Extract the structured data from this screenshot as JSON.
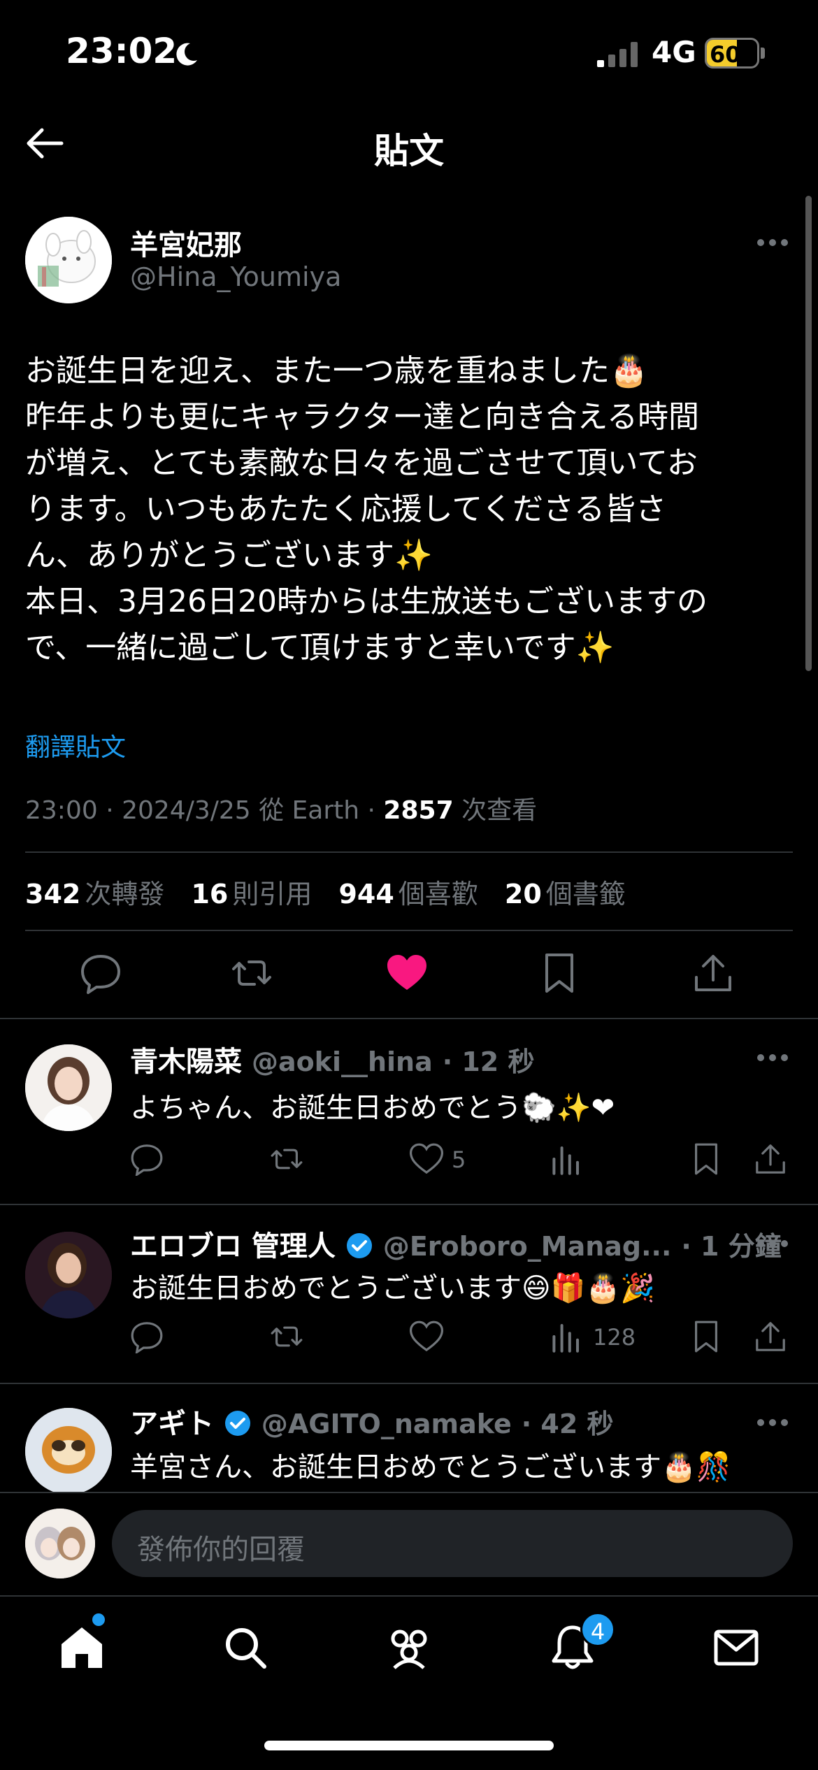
{
  "status_bar": {
    "time": "23:02",
    "network": "4G",
    "battery": "60"
  },
  "header": {
    "title": "貼文"
  },
  "tweet": {
    "author_name": "羊宮妃那",
    "author_handle": "@Hina_Youmiya",
    "text_lines": [
      "お誕生日を迎え、また一つ歳を重ねました🎂",
      "昨年よりも更にキャラクター達と向き合える時間",
      "が増え、とても素敵な日々を過ごさせて頂いてお",
      "ります。いつもあたたく応援してくださる皆さ",
      "ん、ありがとうございます✨",
      "本日、3月26日20時からは生放送もございますの",
      "で、一緒に過ごして頂けますと幸いです✨"
    ],
    "translate_label": "翻譯貼文",
    "meta_prefix": "23:00 · 2024/3/25 從 Earth · ",
    "views": "2857",
    "views_label": "次查看",
    "stats": {
      "retweets": "342",
      "retweets_label": "次轉發",
      "quotes": "16",
      "quotes_label": "則引用",
      "likes": "944",
      "likes_label": "個喜歡",
      "bookmarks": "20",
      "bookmarks_label": "個書籤"
    }
  },
  "replies": [
    {
      "name": "青木陽菜",
      "handle": "@aoki__hina",
      "time": "· 12 秒",
      "text": "よちゃん、お誕生日おめでとう🐑✨❤",
      "likes": "5",
      "views": ""
    },
    {
      "name": "エロブロ 管理人",
      "handle": "@Eroboro_Manag...",
      "time": "· 1 分鐘",
      "text": "お誕生日おめでとうございます😄🎁🎂🎉",
      "likes": "",
      "views": "128"
    },
    {
      "name": "アギト",
      "handle": "@AGITO_namake",
      "time": "· 42 秒",
      "text": "羊宮さん、お誕生日おめでとうございます🎂🎊",
      "likes": "",
      "views": ""
    }
  ],
  "composer": {
    "placeholder": "發佈你的回覆"
  },
  "tabbar": {
    "notifications_badge": "4"
  },
  "colors": {
    "accent": "#1d9bf0",
    "like": "#f91880",
    "background": "#000000",
    "muted": "#71767b"
  }
}
